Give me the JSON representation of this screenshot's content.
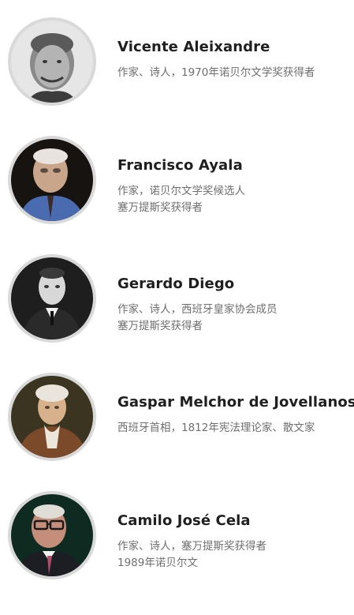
{
  "people": [
    {
      "name": "Vicente Aleixandre",
      "lines": [
        "作家、诗人，1970年诺贝尔文学奖获得者"
      ]
    },
    {
      "name": "Francisco Ayala",
      "lines": [
        "作家，诺贝尔文学奖候选人",
        "塞万提斯奖获得者"
      ]
    },
    {
      "name": "Gerardo Diego",
      "lines": [
        "作家、诗人，西班牙皇家协会成员",
        "塞万提斯奖获得者"
      ]
    },
    {
      "name": "Gaspar Melchor de Jovellanos",
      "lines": [
        "西班牙首相，1812年宪法理论家、散文家"
      ]
    },
    {
      "name": "Camilo José Cela",
      "lines": [
        "作家、诗人，塞万提斯奖获得者",
        "1989年诺贝尔文"
      ]
    }
  ]
}
